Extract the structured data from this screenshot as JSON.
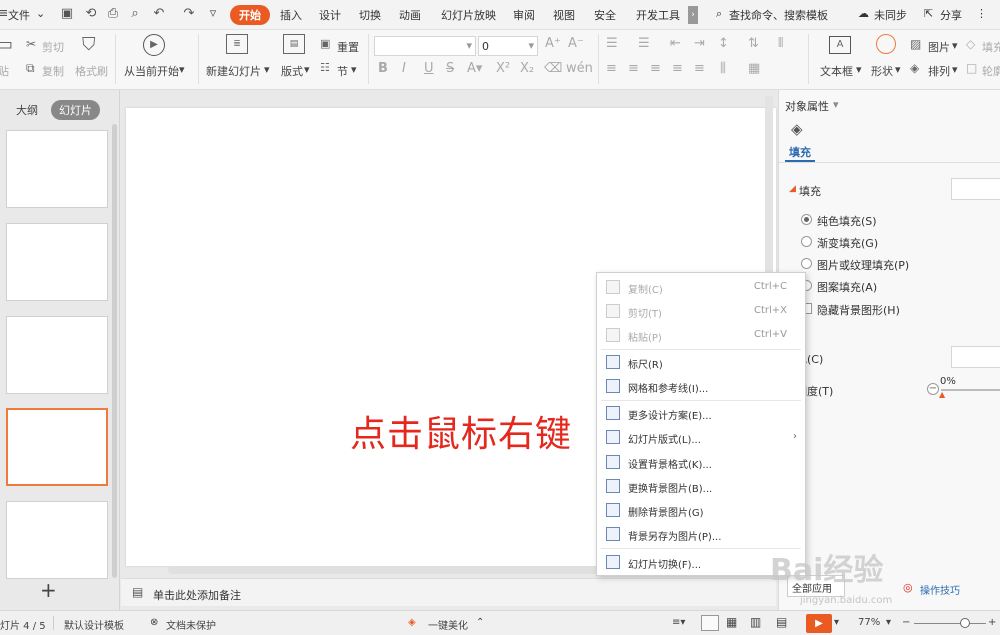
{
  "menu": {
    "file_label": "文件",
    "tabs": [
      "开始",
      "插入",
      "设计",
      "切换",
      "动画",
      "幻灯片放映",
      "审阅",
      "视图",
      "安全",
      "开发工具"
    ],
    "active_tab": "开始",
    "search_label": "查找命令、搜索模板",
    "sync_label": "未同步",
    "share_label": "分享"
  },
  "ribbon": {
    "paste_label": "贴",
    "cut_label": "剪切",
    "copy_label": "复制",
    "format_painter_label": "格式刷",
    "start_from_current_label": "从当前开始",
    "new_slide_label": "新建幻灯片",
    "layout_label": "版式",
    "reset_label": "重置",
    "section_label": "节",
    "font_size_value": "0",
    "textbox_label": "文本框",
    "shape_label": "形状",
    "picture_label": "图片",
    "arrange_label": "排列",
    "fill_label": "填充",
    "outline_label": "轮廓"
  },
  "left_panel": {
    "outline_tab": "大纲",
    "slides_tab": "幻灯片",
    "add_slide": "+"
  },
  "slide": {
    "annotation": "点击鼠标右键"
  },
  "notes": {
    "placeholder": "单击此处添加备注"
  },
  "right_panel": {
    "title": "对象属性",
    "fill_tab": "填充",
    "section_fill": "填充",
    "options": [
      {
        "label": "纯色填充(S)",
        "selected": true,
        "type": "radio"
      },
      {
        "label": "渐变填充(G)",
        "selected": false,
        "type": "radio"
      },
      {
        "label": "图片或纹理填充(P)",
        "selected": false,
        "type": "radio"
      },
      {
        "label": "图案填充(A)",
        "selected": false,
        "type": "radio"
      },
      {
        "label": "隐藏背景图形(H)",
        "selected": false,
        "type": "checkbox"
      }
    ],
    "color_label": "颜色(C)",
    "transparency_label": "透明度(T)",
    "transparency_value": "0%",
    "apply_all_label": "全部应用",
    "tips_label": "操作技巧"
  },
  "context_menu": {
    "items": [
      {
        "label": "复制(C)",
        "shortcut": "Ctrl+C",
        "disabled": true,
        "icon": "copy-icon"
      },
      {
        "label": "剪切(T)",
        "shortcut": "Ctrl+X",
        "disabled": true,
        "icon": "cut-icon"
      },
      {
        "label": "粘贴(P)",
        "shortcut": "Ctrl+V",
        "disabled": true,
        "icon": "paste-icon"
      },
      {
        "label": "标尺(R)",
        "shortcut": "",
        "disabled": false,
        "icon": "ruler-icon"
      },
      {
        "label": "网格和参考线(I)...",
        "shortcut": "",
        "disabled": false,
        "icon": "grid-icon"
      },
      {
        "label": "更多设计方案(E)...",
        "shortcut": "",
        "disabled": false,
        "icon": "design-icon"
      },
      {
        "label": "幻灯片版式(L)...",
        "shortcut": "",
        "disabled": false,
        "icon": "layout-icon",
        "submenu": true
      },
      {
        "label": "设置背景格式(K)...",
        "shortcut": "",
        "disabled": false,
        "icon": "background-format-icon"
      },
      {
        "label": "更换背景图片(B)...",
        "shortcut": "",
        "disabled": false,
        "icon": "change-bg-image-icon"
      },
      {
        "label": "删除背景图片(G)",
        "shortcut": "",
        "disabled": false,
        "icon": "delete-bg-image-icon"
      },
      {
        "label": "背景另存为图片(P)...",
        "shortcut": "",
        "disabled": false,
        "icon": "save-bg-image-icon"
      },
      {
        "label": "幻灯片切换(F)...",
        "shortcut": "",
        "disabled": false,
        "icon": "transition-icon"
      }
    ],
    "submenu_arrow": "›"
  },
  "status": {
    "slide_counter": "灯片 4 / 5",
    "template": "默认设计模板",
    "protection": "文档未保护",
    "beautify": "一键美化",
    "zoom": "77%"
  },
  "watermark": {
    "text": "Bai经验",
    "url": "jingyan.baidu.com"
  },
  "colors": {
    "accent": "#ea5b24",
    "slide_text": "#e4281e",
    "selected_thumb_border": "#f07a3e"
  }
}
